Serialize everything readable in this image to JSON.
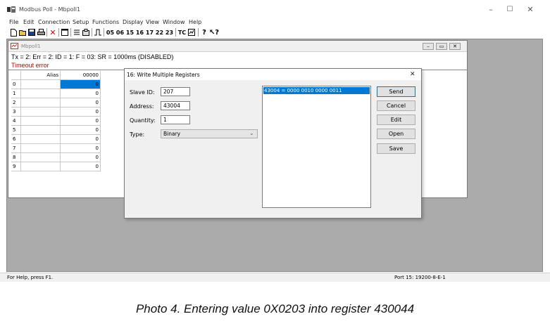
{
  "app": {
    "title": "Modbus Poll - Mbpoll1",
    "menu": [
      "File",
      "Edit",
      "Connection",
      "Setup",
      "Functions",
      "Display",
      "View",
      "Window",
      "Help"
    ],
    "toolbar_codes": [
      "05",
      "06",
      "15",
      "16",
      "17",
      "22",
      "23"
    ],
    "toolbar_tc": "TC"
  },
  "child": {
    "title": "Mbpoll1",
    "status_line": "Tx = 2: Err = 2: ID = 1: F = 03: SR = 1000ms  (DISABLED)",
    "error_text": "Timeout error",
    "table": {
      "headers": [
        "Alias",
        "00000"
      ],
      "rows": [
        {
          "index": "0",
          "value": "0"
        },
        {
          "index": "1",
          "value": "0"
        },
        {
          "index": "2",
          "value": "0"
        },
        {
          "index": "3",
          "value": "0"
        },
        {
          "index": "4",
          "value": "0"
        },
        {
          "index": "5",
          "value": "0"
        },
        {
          "index": "6",
          "value": "0"
        },
        {
          "index": "7",
          "value": "0"
        },
        {
          "index": "8",
          "value": "0"
        },
        {
          "index": "9",
          "value": "0"
        }
      ]
    }
  },
  "dialog": {
    "title": "16: Write Multiple Registers",
    "close": "✕",
    "slave_id_label": "Slave ID:",
    "slave_id": "207",
    "address_label": "Address:",
    "address": "43004",
    "quantity_label": "Quantity:",
    "quantity": "1",
    "type_label": "Type:",
    "type_value": "Binary",
    "list_items": [
      "43004 = 0000 0010 0000 0011"
    ],
    "buttons": {
      "send": "Send",
      "cancel": "Cancel",
      "edit": "Edit",
      "open": "Open",
      "save": "Save"
    }
  },
  "statusbar": {
    "help": "For Help, press F1.",
    "port": "Port 15: 19200-8-E-1"
  },
  "caption": "Photo 4. Entering value 0X0203 into register 430044",
  "colors": {
    "selection": "#0078d7",
    "error": "#cc0000",
    "mdi_background": "#ababab"
  }
}
